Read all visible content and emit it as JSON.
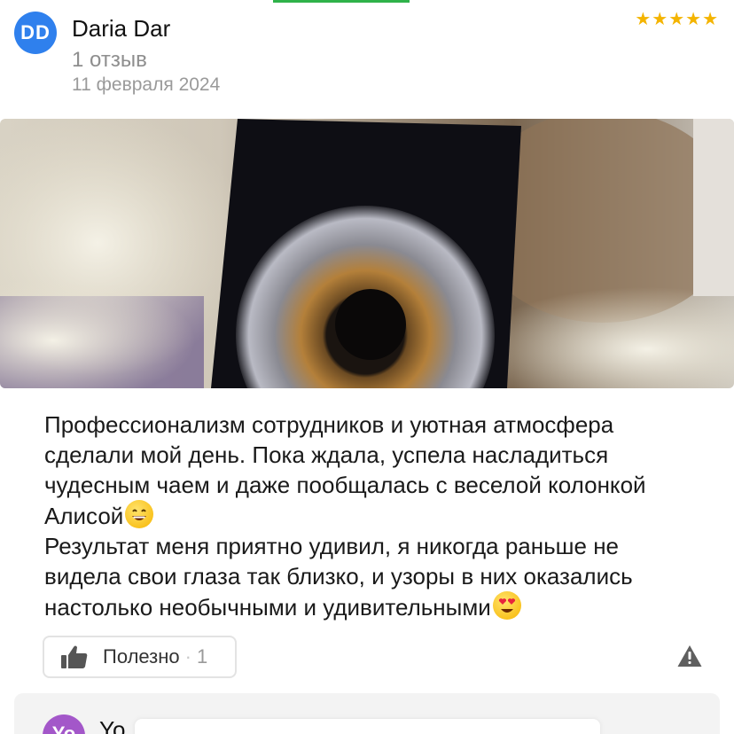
{
  "review": {
    "author": {
      "initials": "DD",
      "name": "Daria Dar",
      "reviews_count": "1 отзыв",
      "avatar_color": "#2f80ed"
    },
    "date": "11 февраля 2024",
    "rating": 5,
    "star_color": "#f4b400",
    "paragraphs": [
      "Профессионализм сотрудников и уютная атмосфера сделали мой день. Пока ждала, успела насладиться чудесным чаем и даже пообщалась с веселой колонкой Алисой",
      "Результат меня приятно удивил, я никогда раньше не видела свои глаза так близко, и узоры в них оказались настолько необычными и удивительными"
    ],
    "paragraph_emojis": [
      "grinning-face",
      "heart-eyes-face"
    ],
    "helpful": {
      "label": "Полезно",
      "separator": "·",
      "count": "1"
    }
  },
  "next_review": {
    "initials": "Yo",
    "name": "Yo",
    "avatar_color": "#a357c9"
  },
  "accent_color": "#2fb24a"
}
